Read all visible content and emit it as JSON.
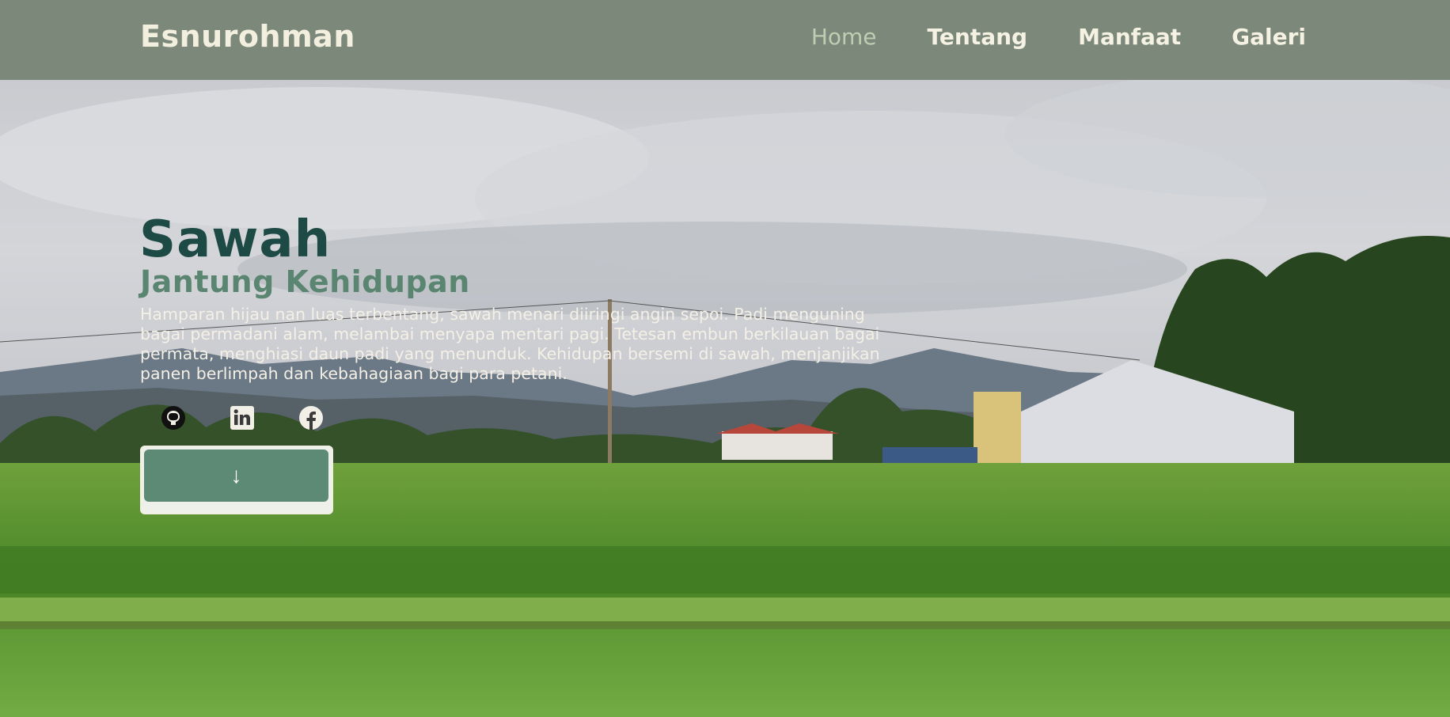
{
  "brand": "Esnurohman",
  "nav": {
    "items": [
      {
        "label": "Home",
        "active": true
      },
      {
        "label": "Tentang",
        "active": false
      },
      {
        "label": "Manfaat",
        "active": false
      },
      {
        "label": "Galeri",
        "active": false
      }
    ]
  },
  "hero": {
    "title": "Sawah",
    "subtitle": "Jantung Kehidupan",
    "text": "Hamparan hijau nan luas terbentang, sawah menari diiringi angin sepoi. Padi menguning bagai permadani alam, melambai menyapa mentari pagi. Tetesan embun berkilauan bagai permata, menghiasi daun padi yang menunduk. Kehidupan bersemi di sawah, menjanjikan panen berlimpah dan kebahagiaan bagi para petani.",
    "scroll_button_label": "↓"
  },
  "socials": [
    {
      "icon": "github-icon"
    },
    {
      "icon": "linkedin-icon"
    },
    {
      "icon": "facebook-icon"
    }
  ],
  "colors": {
    "navbar": "#7b887a",
    "title": "#1e4a46",
    "subtitle": "#5a8570",
    "button": "#5d8a75",
    "nav_active": "#bfceb2"
  }
}
